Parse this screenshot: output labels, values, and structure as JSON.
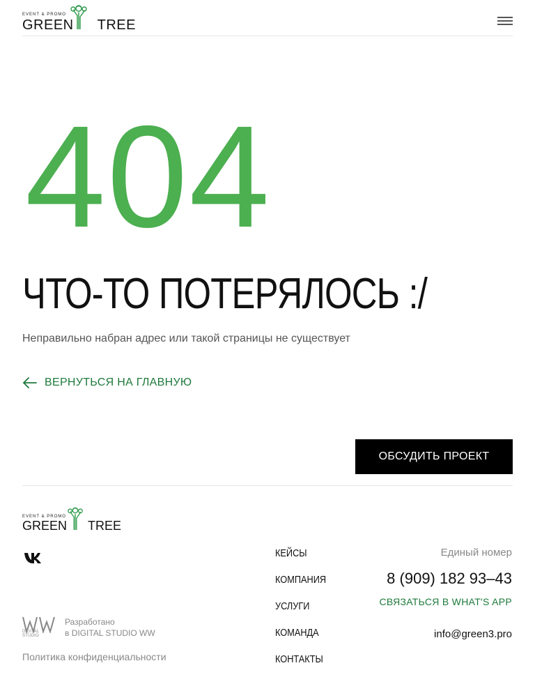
{
  "header": {
    "logo_small": "EVENT & PROMO",
    "logo_green": "GREEN",
    "logo_tree": "TREE",
    "menu_icon": "hamburger-menu-icon"
  },
  "error": {
    "code": "404",
    "title": "ЧТО-ТО ПОТЕРЯЛОСЬ :/",
    "description": "Неправильно набран адрес или такой страницы не существует",
    "back_link": "ВЕРНУТЬСЯ НА ГЛАВНУЮ",
    "back_icon": "arrow-left-icon"
  },
  "cta": {
    "label": "ОБСУДИТЬ ПРОЕКТ"
  },
  "footer": {
    "logo_small": "EVENT & PROMO",
    "logo_green": "GREEN",
    "logo_tree": "TREE",
    "social_icon": "vk-icon",
    "studio_line1": "Разработано",
    "studio_line2": "в DIGITAL STUDIO WW",
    "studio_mark": "DIGITAL STUDIO",
    "privacy": "Политика конфиденциальности",
    "nav": [
      "КЕЙСЫ",
      "КОМПАНИЯ",
      "УСЛУГИ",
      "КОМАНДА",
      "КОНТАКТЫ"
    ],
    "phone_label": "Единый номер",
    "phone": "8 (909) 182 93–43",
    "whatsapp": "СВЯЗАТЬСЯ В WHAT'S APP",
    "email": "info@green3.pro"
  },
  "colors": {
    "accent_green": "#4caf50",
    "link_green": "#1e7a3b",
    "cta_bg": "#000000"
  }
}
